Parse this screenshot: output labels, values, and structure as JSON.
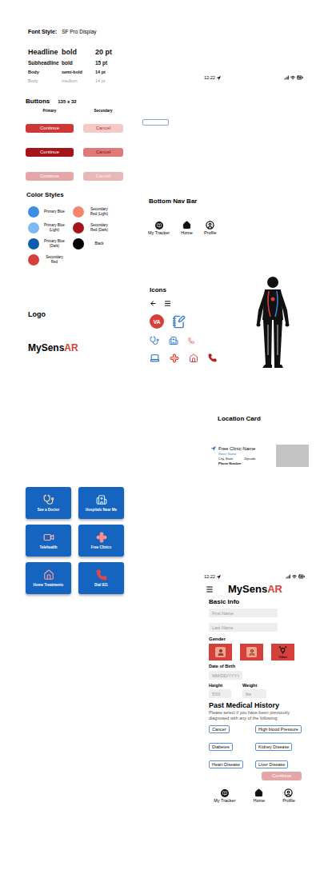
{
  "fontStyle": {
    "label": "Font Style:",
    "value": "SF Pro Display"
  },
  "typeScale": [
    {
      "name": "Headline",
      "weight": "bold",
      "size": "20 pt",
      "muted": false
    },
    {
      "name": "Subheadline",
      "weight": "bold",
      "size": "15 pt",
      "muted": false
    },
    {
      "name": "Body",
      "weight": "semi-bold",
      "size": "14 pt",
      "muted": false
    },
    {
      "name": "Body",
      "weight": "medium",
      "size": "14 pt",
      "muted": true
    }
  ],
  "buttons": {
    "title": "Buttons",
    "size": "135 x 32",
    "columns": [
      "Primary",
      "Secondary"
    ],
    "rows": [
      {
        "kind": "normal",
        "primary": "Continue",
        "secondary": "Cancel"
      },
      {
        "kind": "pressed",
        "primary": "Continue",
        "secondary": "Cancel"
      },
      {
        "kind": "disabled",
        "primary": "Continue",
        "secondary": "Cancel"
      }
    ]
  },
  "colorStyles": {
    "title": "Color Styles",
    "swatches": [
      {
        "label": "Primary Blue",
        "color": "#3d8ee4"
      },
      {
        "label": "Secondary Red (Light)",
        "color": "#f4866e"
      },
      {
        "label": "Primary Blue (Light)",
        "color": "#7db9f3"
      },
      {
        "label": "Secondary Red (Dark)",
        "color": "#a5141a"
      },
      {
        "label": "Primary Blue (Dark)",
        "color": "#0b5cad"
      },
      {
        "label": "Black",
        "color": "#000000"
      },
      {
        "label": "Secondary Red",
        "color": "#d6403a"
      }
    ]
  },
  "logo": {
    "title": "Logo",
    "brand": "MySens",
    "accent": "AR"
  },
  "statusBar": {
    "time": "12:22"
  },
  "bottomNavBar": {
    "title": "Bottom Nav Bar",
    "items": [
      "My Tracker",
      "Home",
      "Profile"
    ]
  },
  "icons": {
    "title": "Icons",
    "avatar": "VA"
  },
  "locationCard": {
    "title": "Location Card",
    "name": "Free Clinic Name",
    "street": "Street Name",
    "city": "City, State",
    "zip": "Zipcode",
    "phone": "Phone Number"
  },
  "tiles": [
    "See a Doctor",
    "Hospitals Near Me",
    "Telehealth",
    "Free Clinics",
    "Home Treatments",
    "Dial 911"
  ],
  "form": {
    "brand": "MySens",
    "accent": "AR",
    "title": "Basic Info",
    "firstName": "First Name",
    "lastName": "Last Name",
    "genderTitle": "Gender",
    "genderOther": "Other",
    "dobLabel": "Date of Birth",
    "dobPlaceholder": "MM/DD/YYYY",
    "heightLabel": "Height",
    "heightPlaceholder": "5'00",
    "weightLabel": "Weight",
    "weightPlaceholder": "lbs",
    "historyTitle": "Past Medical History",
    "historyText": "Please select if you have been previously diagnosed with any of the following:",
    "conditions": [
      {
        "label": "Cancer",
        "selected": false
      },
      {
        "label": "High blood Pressure",
        "selected": false
      },
      {
        "label": "Diabetes",
        "selected": false
      },
      {
        "label": "Kidney Disease",
        "selected": false
      },
      {
        "label": "Heart Disease",
        "selected": false
      },
      {
        "label": "Liver Disease",
        "selected": false
      }
    ],
    "continue": {
      "label": "Continue",
      "disabled": true
    }
  }
}
